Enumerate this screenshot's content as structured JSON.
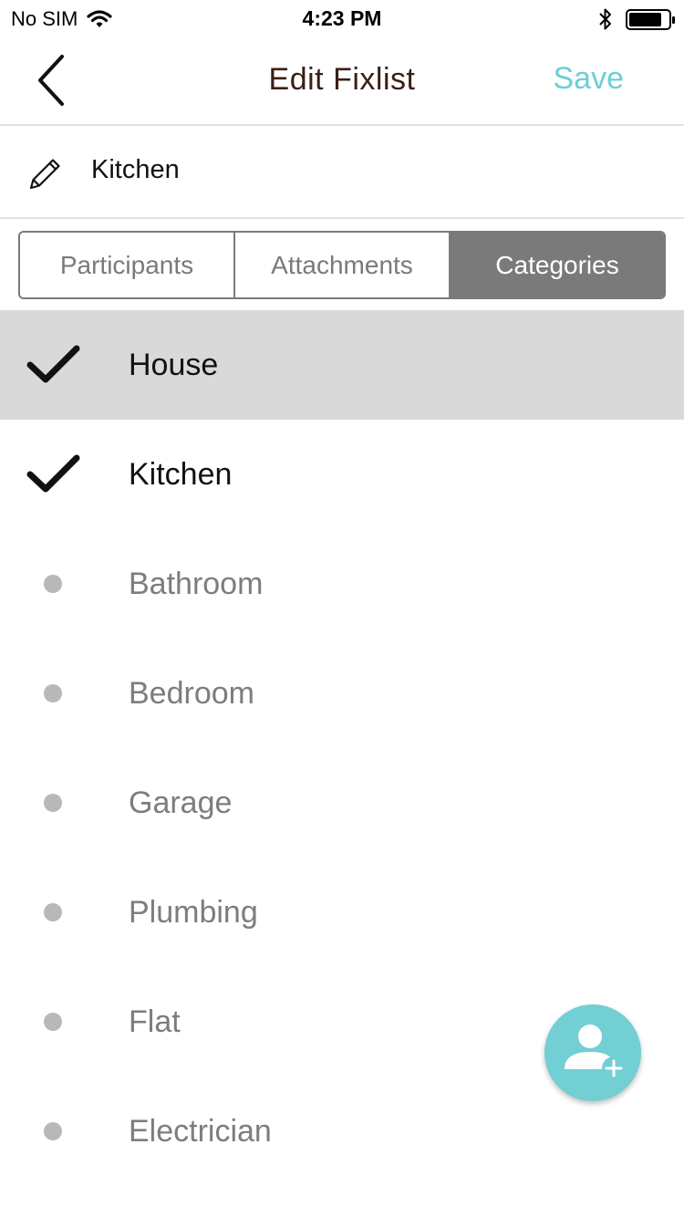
{
  "status_bar": {
    "carrier": "No SIM",
    "time": "4:23 PM",
    "battery_level": 0.8
  },
  "nav": {
    "title": "Edit Fixlist",
    "save_label": "Save",
    "back_icon": "chevron-left-icon"
  },
  "fixlist": {
    "name": "Kitchen",
    "edit_icon": "pencil-icon"
  },
  "tabs": [
    {
      "label": "Participants",
      "active": false
    },
    {
      "label": "Attachments",
      "active": false
    },
    {
      "label": "Categories",
      "active": true
    }
  ],
  "categories": [
    {
      "label": "House",
      "checked": true,
      "highlighted": true
    },
    {
      "label": "Kitchen",
      "checked": true,
      "highlighted": false
    },
    {
      "label": "Bathroom",
      "checked": false,
      "highlighted": false
    },
    {
      "label": "Bedroom",
      "checked": false,
      "highlighted": false
    },
    {
      "label": "Garage",
      "checked": false,
      "highlighted": false
    },
    {
      "label": "Plumbing",
      "checked": false,
      "highlighted": false
    },
    {
      "label": "Flat",
      "checked": false,
      "highlighted": false
    },
    {
      "label": "Electrician",
      "checked": false,
      "highlighted": false
    }
  ],
  "fab": {
    "icon": "add-user-icon"
  },
  "colors": {
    "accent": "#6ccfd3",
    "fab": "#72cfd4",
    "title": "#3a1f14",
    "segment": "#7a7a7a",
    "highlight_row": "#d9d9d9"
  }
}
